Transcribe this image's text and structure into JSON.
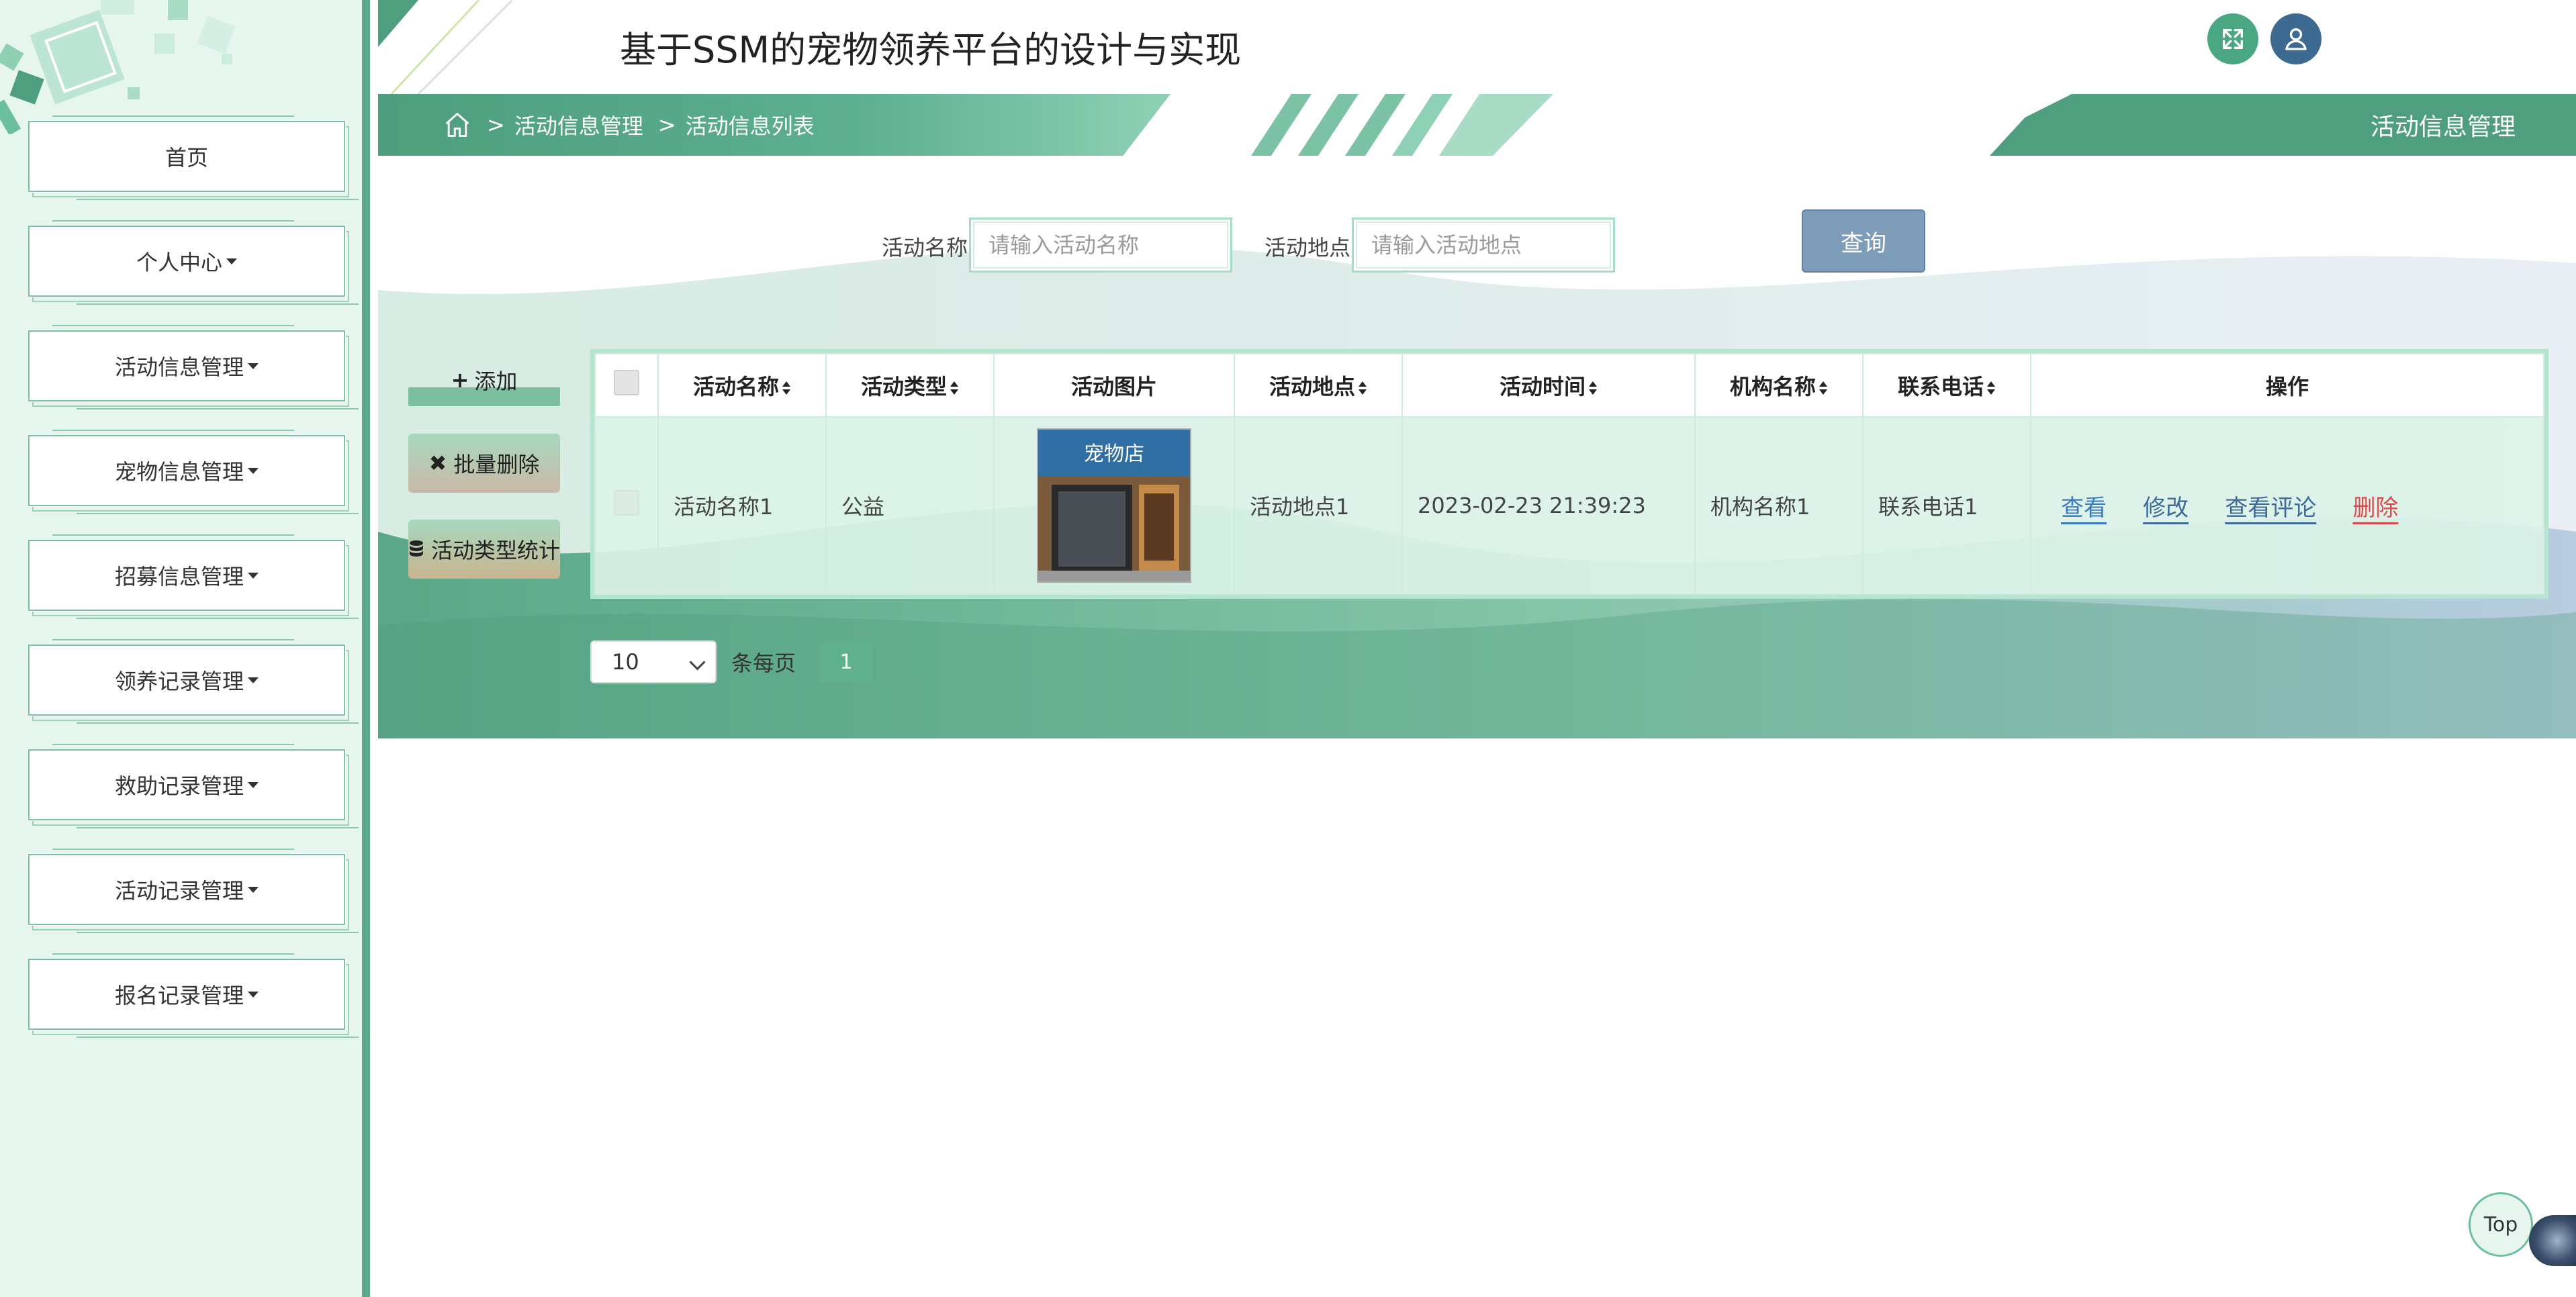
{
  "app": {
    "title": "基于SSM的宠物领养平台的设计与实现"
  },
  "header": {
    "fullscreen_icon": "expand-icon",
    "user_icon": "user-icon"
  },
  "breadcrumb": {
    "home_icon": "home-icon",
    "separator": ">",
    "items": [
      "活动信息管理",
      "活动信息列表"
    ]
  },
  "page_tag": "活动信息管理",
  "sidebar": {
    "items": [
      {
        "label": "首页",
        "dropdown": false
      },
      {
        "label": "个人中心",
        "dropdown": true
      },
      {
        "label": "活动信息管理",
        "dropdown": true
      },
      {
        "label": "宠物信息管理",
        "dropdown": true
      },
      {
        "label": "招募信息管理",
        "dropdown": true
      },
      {
        "label": "领养记录管理",
        "dropdown": true
      },
      {
        "label": "救助记录管理",
        "dropdown": true
      },
      {
        "label": "活动记录管理",
        "dropdown": true
      },
      {
        "label": "报名记录管理",
        "dropdown": true
      }
    ]
  },
  "search": {
    "name_label": "活动名称",
    "name_placeholder": "请输入活动名称",
    "name_value": "",
    "place_label": "活动地点",
    "place_placeholder": "请输入活动地点",
    "place_value": "",
    "query_label": "查询"
  },
  "actions": {
    "add_label": "添加",
    "add_icon": "plus-icon",
    "batch_delete_label": "批量删除",
    "batch_delete_icon": "close-icon",
    "stats_label": "活动类型统计",
    "stats_icon": "database-icon"
  },
  "table": {
    "columns": [
      "活动名称",
      "活动类型",
      "活动图片",
      "活动地点",
      "活动时间",
      "机构名称",
      "联系电话",
      "操作"
    ],
    "rows": [
      {
        "name": "活动名称1",
        "type": "公益",
        "image_alt": "店铺门面照片",
        "image_sign": "宠物店",
        "place": "活动地点1",
        "time": "2023-02-23 21:39:23",
        "org": "机构名称1",
        "phone": "联系电话1",
        "ops": {
          "view": "查看",
          "edit": "修改",
          "comments": "查看评论",
          "delete": "删除"
        }
      }
    ]
  },
  "pagination": {
    "page_size": "10",
    "per_page_label": "条每页",
    "current_page": "1"
  },
  "float": {
    "top_label": "Top"
  },
  "colors": {
    "primary_green": "#5aa889",
    "query_blue": "#7e9cb7",
    "delete_red": "#d84a4a",
    "link_blue": "#3a7bbf"
  }
}
